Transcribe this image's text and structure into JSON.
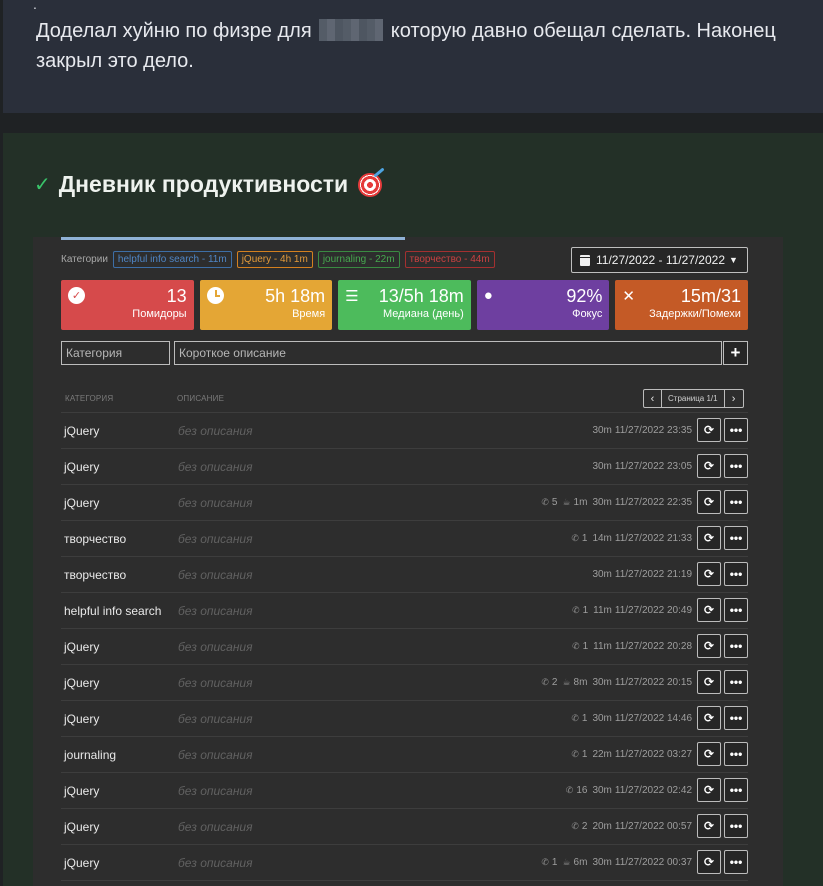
{
  "post": {
    "dot": ".",
    "text_before": "Доделал хуйню по физре для",
    "text_after": "которую давно обещал сделать. Наконец закрыл это дело."
  },
  "diary": {
    "title": "Дневник продуктивности"
  },
  "filters": {
    "categories_label": "Категории",
    "tags": [
      {
        "label": "helpful info search - 11m"
      },
      {
        "label": "jQuery - 4h 1m"
      },
      {
        "label": "journaling - 22m"
      },
      {
        "label": "творчество - 44m"
      }
    ],
    "date_range": "11/27/2022 - 11/27/2022"
  },
  "stats": [
    {
      "value": "13",
      "label": "Помидоры",
      "icon": "check-circle-icon"
    },
    {
      "value": "5h 18m",
      "label": "Время",
      "icon": "clock-icon"
    },
    {
      "value": "13/5h 18m",
      "label": "Медиана (день)",
      "icon": "list-icon"
    },
    {
      "value": "92%",
      "label": "Фокус",
      "icon": "lightbulb-icon"
    },
    {
      "value": "15m/31",
      "label": "Задержки/Помехи",
      "icon": "x-icon"
    }
  ],
  "form": {
    "category_placeholder": "Категория",
    "description_placeholder": "Короткое описание",
    "add_label": "+"
  },
  "table": {
    "col_category": "КАТЕГОРИЯ",
    "col_description": "ОПИСАНИЕ",
    "page_label": "Страница 1/1",
    "prev": "‹",
    "next": "›",
    "rows": [
      {
        "category": "jQuery",
        "description": "без описания",
        "calls": "",
        "breaks": "",
        "duration": "30m",
        "datetime": "11/27/2022 23:35"
      },
      {
        "category": "jQuery",
        "description": "без описания",
        "calls": "",
        "breaks": "",
        "duration": "30m",
        "datetime": "11/27/2022 23:05"
      },
      {
        "category": "jQuery",
        "description": "без описания",
        "calls": "5",
        "breaks": "1m",
        "duration": "30m",
        "datetime": "11/27/2022 22:35"
      },
      {
        "category": "творчество",
        "description": "без описания",
        "calls": "1",
        "breaks": "",
        "duration": "14m",
        "datetime": "11/27/2022 21:33"
      },
      {
        "category": "творчество",
        "description": "без описания",
        "calls": "",
        "breaks": "",
        "duration": "30m",
        "datetime": "11/27/2022 21:19"
      },
      {
        "category": "helpful info search",
        "description": "без описания",
        "calls": "1",
        "breaks": "",
        "duration": "11m",
        "datetime": "11/27/2022 20:49"
      },
      {
        "category": "jQuery",
        "description": "без описания",
        "calls": "1",
        "breaks": "",
        "duration": "11m",
        "datetime": "11/27/2022 20:28"
      },
      {
        "category": "jQuery",
        "description": "без описания",
        "calls": "2",
        "breaks": "8m",
        "duration": "30m",
        "datetime": "11/27/2022 20:15"
      },
      {
        "category": "jQuery",
        "description": "без описания",
        "calls": "1",
        "breaks": "",
        "duration": "30m",
        "datetime": "11/27/2022 14:46"
      },
      {
        "category": "journaling",
        "description": "без описания",
        "calls": "1",
        "breaks": "",
        "duration": "22m",
        "datetime": "11/27/2022 03:27"
      },
      {
        "category": "jQuery",
        "description": "без описания",
        "calls": "16",
        "breaks": "",
        "duration": "30m",
        "datetime": "11/27/2022 02:42"
      },
      {
        "category": "jQuery",
        "description": "без описания",
        "calls": "2",
        "breaks": "",
        "duration": "20m",
        "datetime": "11/27/2022 00:57"
      },
      {
        "category": "jQuery",
        "description": "без описания",
        "calls": "1",
        "breaks": "6m",
        "duration": "30m",
        "datetime": "11/27/2022 00:37"
      }
    ]
  }
}
